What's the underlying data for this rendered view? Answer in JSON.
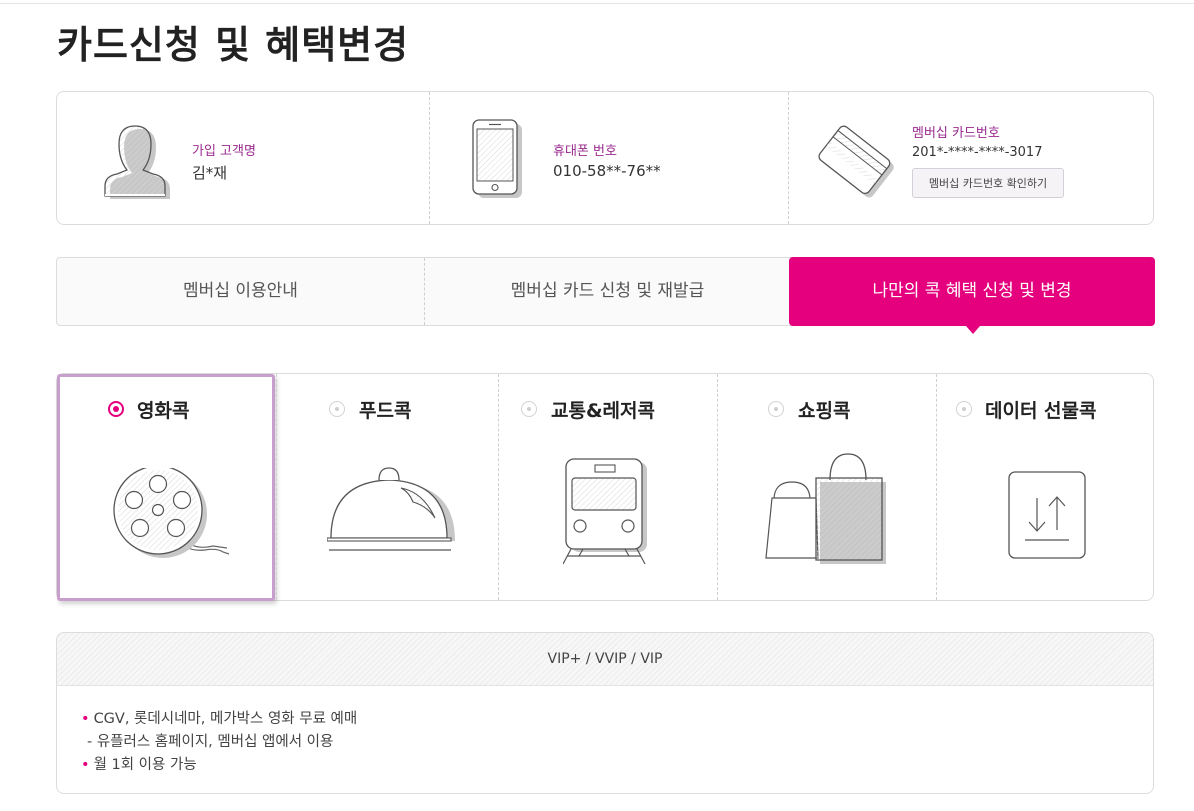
{
  "page": {
    "title": "카드신청 및 혜택변경"
  },
  "member_info": {
    "name": {
      "label": "가입 고객명",
      "value": "김*재"
    },
    "phone": {
      "label": "휴대폰 번호",
      "value": "010-58**-76**"
    },
    "card": {
      "label": "멤버십 카드번호",
      "value": "201*-****-****-3017",
      "button": "멤버십 카드번호 확인하기"
    },
    "icons": [
      "person-icon",
      "smartphone-icon",
      "card-icon"
    ]
  },
  "tabs": [
    {
      "label": "멤버십 이용안내",
      "active": false
    },
    {
      "label": "멤버십 카드 신청 및 재발급",
      "active": false
    },
    {
      "label": "나만의 콕 혜택 신청 및 변경",
      "active": true
    }
  ],
  "categories": [
    {
      "label": "영화콕",
      "selected": true,
      "icon": "film-reel-icon"
    },
    {
      "label": "푸드콕",
      "selected": false,
      "icon": "food-cloche-icon"
    },
    {
      "label": "교통&레저콕",
      "selected": false,
      "icon": "train-icon"
    },
    {
      "label": "쇼핑콕",
      "selected": false,
      "icon": "shopping-bag-icon"
    },
    {
      "label": "데이터 선물콕",
      "selected": false,
      "icon": "data-transfer-icon"
    }
  ],
  "benefit": {
    "grade": "VIP+ / VVIP / VIP",
    "lines": [
      "CGV, 롯데시네마, 메가박스 영화 무료 예매",
      "- 유플러스 홈페이지, 멤버십 앱에서 이용",
      "월 1회 이용 가능"
    ]
  },
  "colors": {
    "accent": "#e5007d",
    "label_purple": "#9b2a8f",
    "selected_border": "#c89fcc"
  }
}
